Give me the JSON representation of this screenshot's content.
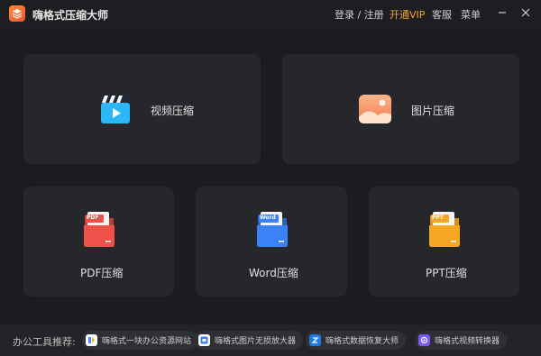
{
  "app": {
    "title": "嗨格式压缩大师",
    "nav": {
      "login": "登录 / 注册",
      "vip": "开通VIP",
      "service": "客服",
      "menu": "菜单"
    }
  },
  "cards": {
    "video": "视频压缩",
    "image": "图片压缩",
    "pdf": "PDF压缩",
    "word": "Word压缩",
    "ppt": "PPT压缩"
  },
  "file_badges": {
    "pdf": "PDF",
    "word": "Word",
    "ppt": "PPT"
  },
  "footer": {
    "label": "办公工具推荐:",
    "tools": [
      "嗨格式一块办公资源网站",
      "嗨格式图片无损放大器",
      "嗨格式数据恢复大师",
      "嗨格式视频转换器"
    ]
  },
  "colors": {
    "accent": "#f5a623",
    "pdf": "#f0504a",
    "word": "#3b82f6",
    "ppt": "#f5a623"
  }
}
